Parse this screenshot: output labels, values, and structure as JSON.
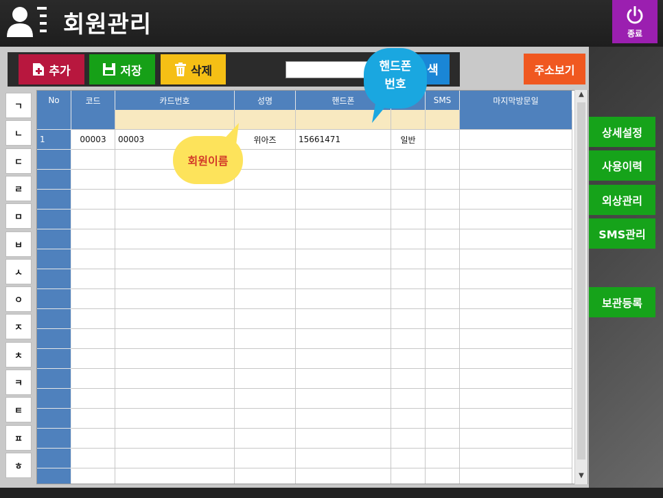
{
  "header": {
    "title": "회원관리",
    "exit_label": "종료"
  },
  "toolbar": {
    "add_label": "추가",
    "save_label": "저장",
    "delete_label": "삭제",
    "search_value": "",
    "search_label": "색",
    "address_label": "주소보기"
  },
  "index": [
    "ㄱ",
    "ㄴ",
    "ㄷ",
    "ㄹ",
    "ㅁ",
    "ㅂ",
    "ㅅ",
    "ㅇ",
    "ㅈ",
    "ㅊ",
    "ㅋ",
    "ㅌ",
    "ㅍ",
    "ㅎ"
  ],
  "grid": {
    "columns": [
      "No",
      "코드",
      "카드번호",
      "성명",
      "핸드폰",
      "",
      "SMS",
      "마지막방문일"
    ],
    "rows": [
      [
        "1",
        "00003",
        "00003",
        "위아즈",
        "15661471",
        "일반",
        "",
        ""
      ]
    ],
    "total_rows": 18
  },
  "side_buttons": {
    "detail": "상세설정",
    "history": "사용이력",
    "credit": "외상관리",
    "sms": "SMS관리",
    "storage": "보관등록"
  },
  "callouts": {
    "phone_line1": "핸드폰",
    "phone_line2": "번호",
    "name": "회원이름"
  },
  "colors": {
    "header_bg": "#1e1e1e",
    "exit": "#9b1fb0",
    "add": "#b8173e",
    "save": "#16a017",
    "delete": "#f5bf15",
    "search": "#1a86d6",
    "address": "#f05820",
    "grid_header": "#4f81bd",
    "side_button": "#16a31a"
  }
}
